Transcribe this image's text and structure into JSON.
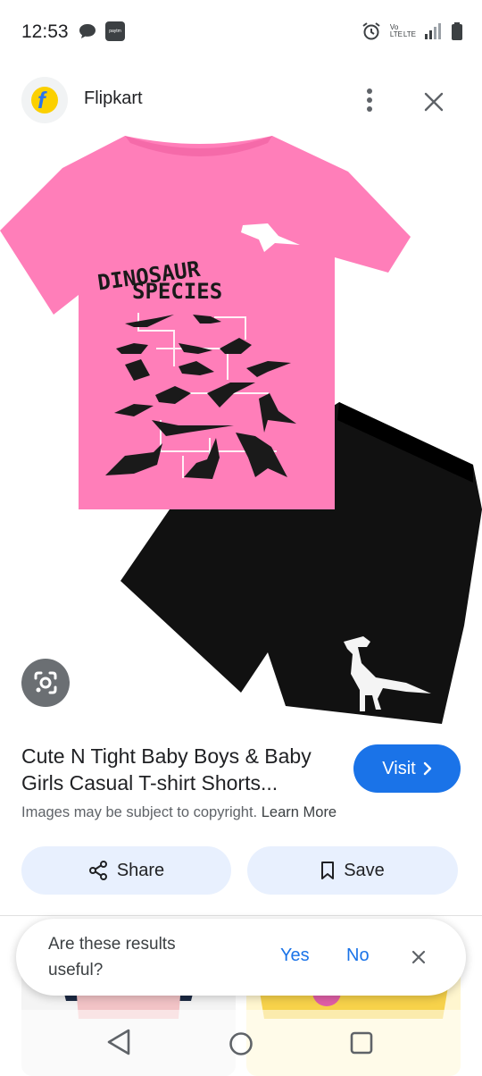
{
  "status_bar": {
    "time": "12:53",
    "left_icons": [
      "chat-bubble-icon",
      "paytm-icon"
    ],
    "paytm_label": "paytm",
    "right_icons": [
      "alarm-icon",
      "volte-lte-icon",
      "signal-icon",
      "battery-icon"
    ],
    "volte_label": "Vo LTE",
    "lte_label": "LTE"
  },
  "header": {
    "source_name": "Flipkart",
    "logo_letter": "f"
  },
  "product_image": {
    "shirt_text_line1": "DINOSAUR",
    "shirt_text_line2": "SPECIES",
    "shirt_color": "#ff7eb9",
    "shorts_color": "#111111"
  },
  "product": {
    "title": "Cute N Tight Baby Boys & Baby Girls Casual T-shirt Shorts...",
    "visit_label": "Visit",
    "copyright_text": "Images may be subject to copyright.",
    "learn_more_label": "Learn More"
  },
  "actions": {
    "share_label": "Share",
    "save_label": "Save"
  },
  "feedback": {
    "question": "Are these results useful?",
    "yes_label": "Yes",
    "no_label": "No"
  },
  "colors": {
    "accent": "#1a73e8",
    "button_bg": "#e8f0fe"
  }
}
